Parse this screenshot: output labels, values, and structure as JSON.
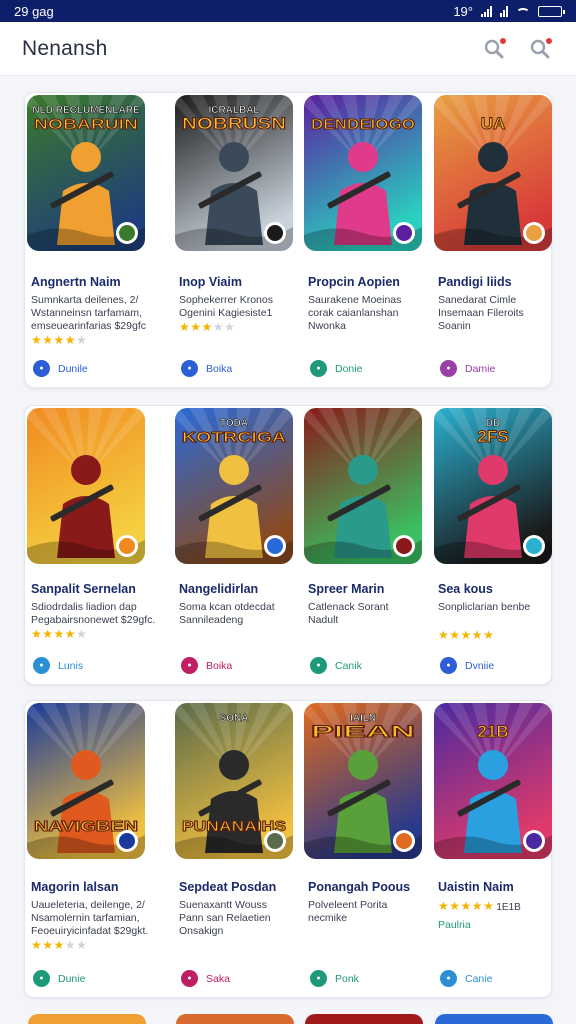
{
  "status_bar": {
    "time": "29 gag",
    "right_text": "19°"
  },
  "app_bar": {
    "title": "Nenansh"
  },
  "rows": [
    {
      "cards": [
        {
          "title": "Angnertn Naim",
          "desc": [
            "Sumnkarta deilenes, 2/",
            "Wstanneinsn tarfamam,",
            "emseuearinfarias $29gfc"
          ],
          "stars": 4,
          "action_label": "Dunile",
          "action_color": "#2c5fd6",
          "thumb_text": "NOBARUIN",
          "thumb_sub": "NLD RECLUMENLARE"
        },
        {
          "title": "Inop Viaim",
          "desc": [
            "Sophekerrer Kronos",
            "Ogenini Kagiesiste1"
          ],
          "stars": 3,
          "action_label": "Boika",
          "action_color": "#2c5fd6",
          "thumb_text": "NOBRUSN",
          "thumb_sub": "ICRALBAL"
        },
        {
          "title": "Propcin Aopien",
          "desc": [
            "Saurakene Moeinas",
            "corak caianlanshan",
            "Nwonka"
          ],
          "stars": 0,
          "action_label": "Donie",
          "action_color": "#1e9a7a",
          "thumb_text": "DENDEIOGO",
          "thumb_sub": ""
        },
        {
          "title": "Pandigi liids",
          "desc": [
            "Sanedarat Cimle",
            "Insemaan Fileroits",
            "Soanin"
          ],
          "stars": 0,
          "action_label": "Damie",
          "action_color": "#9a3fa8",
          "thumb_text": "UA",
          "thumb_sub": ""
        }
      ]
    },
    {
      "cards": [
        {
          "title": "Sanpalit Sernelan",
          "desc": [
            "Sdiodrdalis liadion dap",
            "Pegabairsnonewet $29gfc."
          ],
          "stars": 4,
          "action_label": "Lunis",
          "action_color": "#2c8fd6",
          "thumb_text": "",
          "thumb_sub": ""
        },
        {
          "title": "Nangelidirlan",
          "desc": [
            "Soma kcan otdecdat",
            "Sannileadeng"
          ],
          "stars": 0,
          "action_label": "Boika",
          "action_color": "#c01e62",
          "thumb_text": "KOTRCIGA",
          "thumb_sub": "TODA"
        },
        {
          "title": "Spreer Marin",
          "desc": [
            "Catlenack Sorant",
            "Nadult"
          ],
          "stars": 0,
          "action_label": "Canik",
          "action_color": "#1e9a7a",
          "thumb_text": "",
          "thumb_sub": ""
        },
        {
          "title": "Sea kous",
          "desc": [
            "Sonpliclarian benbe"
          ],
          "stars": 5,
          "action_label": "Dvniie",
          "action_color": "#2c5fd6",
          "thumb_text": "2FS",
          "thumb_sub": "DD"
        }
      ]
    },
    {
      "cards": [
        {
          "title": "Magorin lalsan",
          "desc": [
            "Uaueleteria, deilenge, 2/",
            "Nsamolernin tarfamian,",
            "Feoeuiryicinfadat $29gkt."
          ],
          "stars": 3,
          "action_label": "Dunie",
          "action_color": "#1e9a7a",
          "thumb_text": "NAVIGBEN",
          "thumb_sub": ""
        },
        {
          "title": "Sepdeat Posdan",
          "desc": [
            "Suenaxantt Wouss",
            "Pann san Relaetien",
            "Onsakign"
          ],
          "stars": 0,
          "action_label": "Saka",
          "action_color": "#c01e62",
          "thumb_text": "PUNANAIHS",
          "thumb_sub": "SONA"
        },
        {
          "title": "Ponangah Poous",
          "desc": [
            "Polveleent Porita",
            "necmike"
          ],
          "stars": 0,
          "action_label": "Ponk",
          "action_color": "#1e9a7a",
          "thumb_text": "PIEAN",
          "thumb_sub": "IAILN"
        },
        {
          "title": "Uaistin Naim",
          "desc": [],
          "stars": 5,
          "rating_num": "1E1B",
          "tag": "Paulria",
          "action_label": "Canie",
          "action_color": "#2c8fd6",
          "thumb_text": "21B",
          "thumb_sub": ""
        }
      ]
    }
  ]
}
